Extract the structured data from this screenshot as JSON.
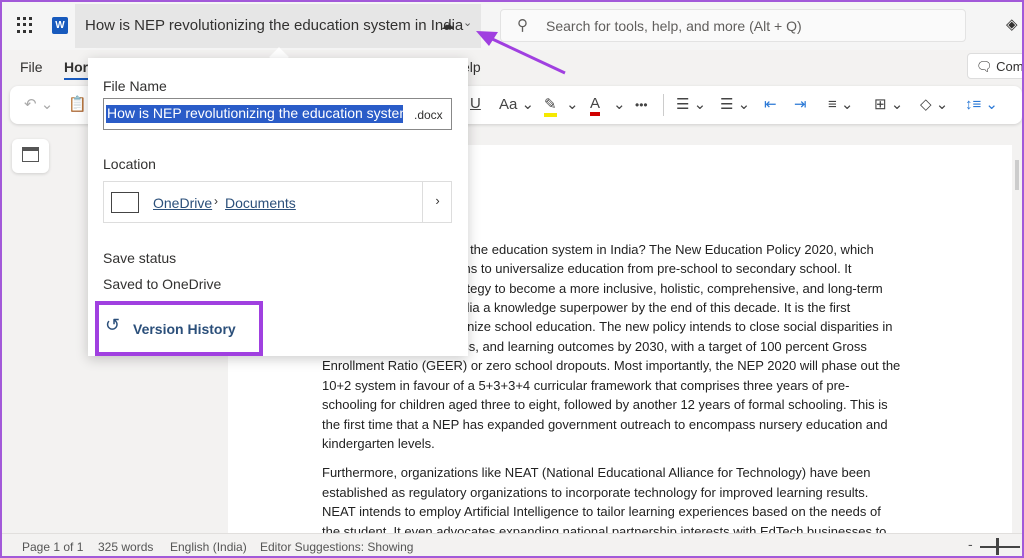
{
  "header": {
    "doc_title": "How is NEP revolutionizing the education system in India",
    "search_placeholder": "Search for tools, help, and more (Alt + Q)",
    "comments_label": "Comm"
  },
  "menu": {
    "file": "File",
    "home": "Hor",
    "help": "elp"
  },
  "toolbar": {
    "font_case": "Aa",
    "more": "•••",
    "highlight_color": "#f5e900",
    "font_color": "#d00000"
  },
  "popup": {
    "file_name_label": "File Name",
    "file_name_value": "How is NEP revolutionizing the education system",
    "extension": ".docx",
    "location_label": "Location",
    "location_root": "OneDrive",
    "location_folder": "Documents",
    "save_status_label": "Save status",
    "save_status_value": "Saved to OneDrive",
    "version_history": "Version History"
  },
  "document": {
    "lines": [
      "ng the education system in India? The New Education Policy 2020, which",
      "ims to universalize education from pre-school to secondary school. It",
      "rategy to become a more inclusive, holistic, comprehensive, and long-term",
      "ndia a knowledge superpower by the end of this decade. It is the first",
      "lonize school education. The new policy intends to close social disparities in",
      "ess, and learning outcomes by 2030, with a target of 100 percent Gross",
      "Enrollment Ratio (GEER) or zero school dropouts. Most importantly, the NEP 2020 will phase out the",
      "10+2 system in favour of a 5+3+3+4 curricular framework that comprises three years of pre-",
      "schooling for children aged three to eight, followed by another 12 years of formal schooling. This is",
      "the first time that a NEP has expanded government outreach to encompass nursery education and",
      "kindergarten levels.",
      "Furthermore, organizations like NEAT (National Educational Alliance for Technology) have been",
      "established as regulatory organizations to incorporate technology for improved learning results.",
      "NEAT intends to employ Artificial Intelligence to tailor learning experiences based on the needs of",
      "the student. It even advocates expanding national partnership interests with EdTech businesses to"
    ]
  },
  "status": {
    "page": "Page 1 of 1",
    "words": "325 words",
    "language": "English (India)",
    "editor": "Editor Suggestions: Showing"
  },
  "annotation_color": "#a040e0"
}
